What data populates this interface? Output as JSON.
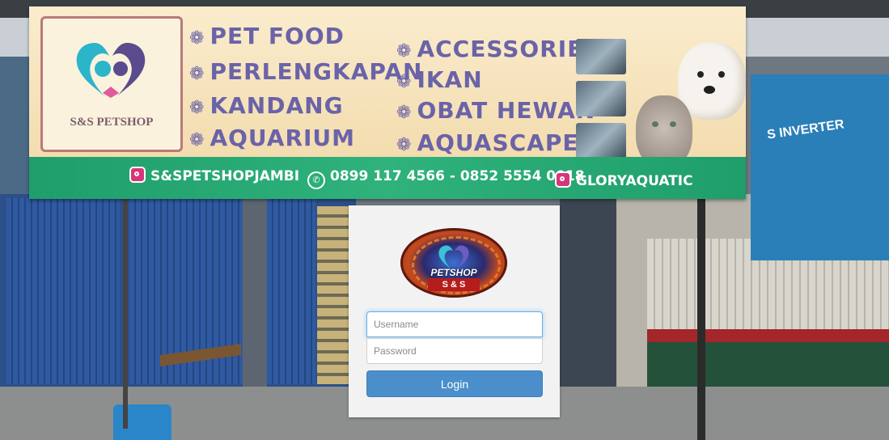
{
  "banner": {
    "logo_text": "S&S PETSHOP",
    "categories_left": [
      "PET FOOD",
      "PERLENGKAPAN",
      "KANDANG",
      "AQUARIUM"
    ],
    "categories_right": [
      "ACCESSORIES",
      "IKAN",
      "OBAT HEWAN",
      "AQUASCAPE"
    ],
    "instagram_1": "S&SPETSHOPJAMBI",
    "phone": "0899 117 4566 - 0852 5554 0018",
    "instagram_2": "GLORYAQUATIC",
    "paw_icon": "paw-icon",
    "accent_green": "#1f9e6b",
    "category_color": "#6a63a8"
  },
  "background": {
    "right_banner_text": "S INVERTER"
  },
  "login": {
    "badge_text": "PETSHOP",
    "badge_sub": "S & S",
    "username_placeholder": "Username",
    "password_placeholder": "Password",
    "button_label": "Login",
    "button_color": "#4a8fcb"
  }
}
